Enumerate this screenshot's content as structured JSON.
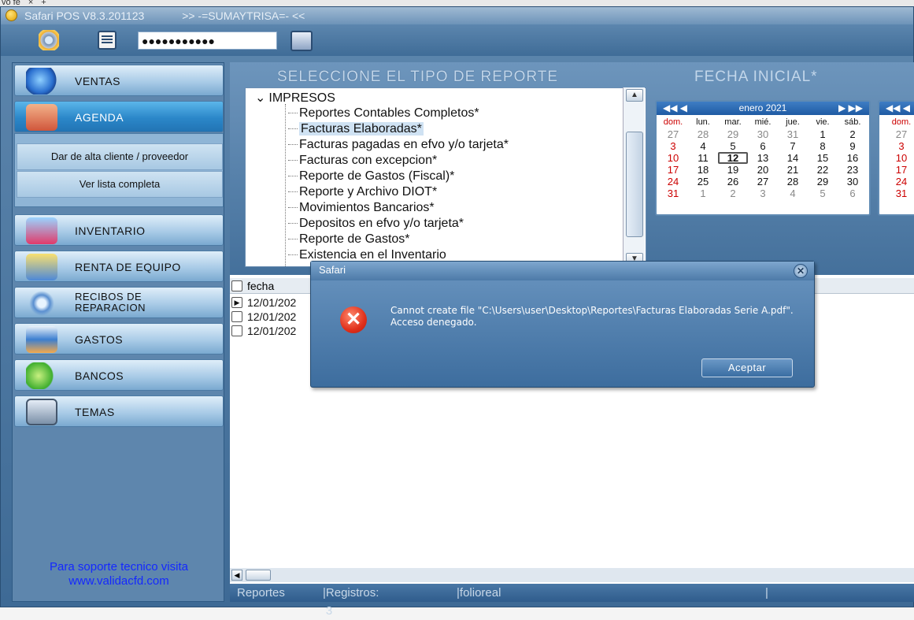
{
  "background_strip": {
    "text": "vo fe",
    "close": "×",
    "plus": "+"
  },
  "window": {
    "title": "Safari POS V8.3.201123",
    "subtitle": ">> -=SUMAYTRISA=- <<"
  },
  "toolbar": {
    "password_mask": "●●●●●●●●●●●"
  },
  "sidebar": {
    "items": [
      {
        "label": "VENTAS"
      },
      {
        "label": "AGENDA"
      },
      {
        "label": "INVENTARIO"
      },
      {
        "label": "RENTA DE EQUIPO"
      },
      {
        "label_line1": "RECIBOS DE",
        "label_line2": "REPARACION"
      },
      {
        "label": "GASTOS"
      },
      {
        "label": "BANCOS"
      },
      {
        "label": "TEMAS"
      }
    ],
    "sub_items": [
      {
        "label": "Dar de alta cliente / proveedor"
      },
      {
        "label": "Ver lista completa"
      }
    ],
    "support_line1": "Para soporte tecnico visita",
    "support_line2": "www.validacfd.com"
  },
  "report_panel": {
    "header_tipo": "SELECCIONE EL TIPO DE REPORTE",
    "header_fecha": "FECHA INICIAL*",
    "tree_root": "IMPRESOS",
    "tree_items": [
      "Reportes Contables Completos*",
      "Facturas Elaboradas*",
      "Facturas pagadas en efvo y/o tarjeta*",
      "Facturas con excepcion*",
      "Reporte de Gastos (Fiscal)*",
      "Reporte y Archivo DIOT*",
      "Movimientos Bancarios*",
      "Depositos en efvo y/o tarjeta*",
      "Reporte de Gastos*",
      "Existencia en el Inventario"
    ],
    "selected_index": 1
  },
  "calendar": {
    "month": "enero 2021",
    "nav_prev": "◀◀  ◀",
    "nav_next": "▶  ▶▶",
    "weekdays": [
      "dom.",
      "lun.",
      "mar.",
      "mié.",
      "jue.",
      "vie.",
      "sáb."
    ],
    "weeks": [
      [
        "27",
        "28",
        "29",
        "30",
        "31",
        "1",
        "2"
      ],
      [
        "3",
        "4",
        "5",
        "6",
        "7",
        "8",
        "9"
      ],
      [
        "10",
        "11",
        "12",
        "13",
        "14",
        "15",
        "16"
      ],
      [
        "17",
        "18",
        "19",
        "20",
        "21",
        "22",
        "23"
      ],
      [
        "24",
        "25",
        "26",
        "27",
        "28",
        "29",
        "30"
      ],
      [
        "31",
        "1",
        "2",
        "3",
        "4",
        "5",
        "6"
      ]
    ],
    "today": "12",
    "second_partial_weekday": "dom.",
    "second_partial_days": [
      "27",
      "3",
      "10",
      "17",
      "24",
      "31"
    ]
  },
  "grid": {
    "header": "fecha",
    "rows": [
      "12/01/202",
      "12/01/202",
      "12/01/202"
    ]
  },
  "status": {
    "section": "Reportes",
    "records": "Registros: 3",
    "field": "folioreal"
  },
  "dialog": {
    "title": "Safari",
    "message": "Cannot create file \"C:\\Users\\user\\Desktop\\Reportes\\Facturas Elaboradas Serie A.pdf\". Acceso denegado.",
    "ok_label": "Aceptar"
  }
}
